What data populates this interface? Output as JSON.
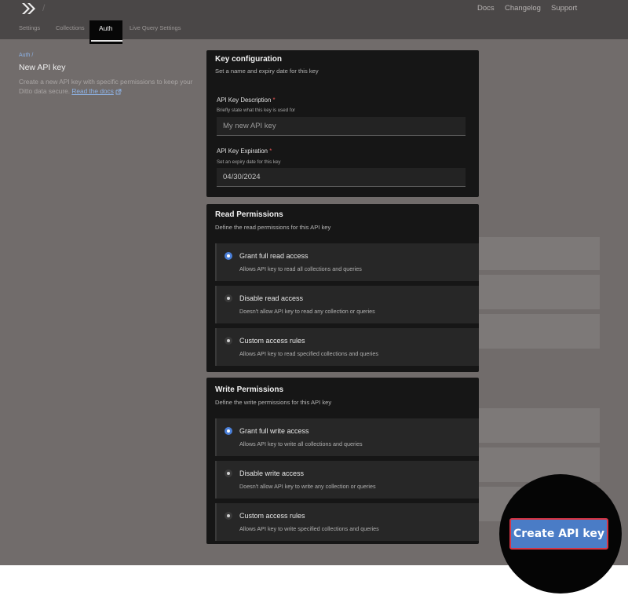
{
  "header": {
    "links": [
      "Docs",
      "Changelog",
      "Support"
    ],
    "tabs": [
      "Settings",
      "Collections",
      "Auth",
      "Live Query Settings"
    ],
    "active_tab": "Auth",
    "divider": "/"
  },
  "page": {
    "breadcrumb": "Auth /",
    "title": "New API key",
    "description": "Create a new API key with specific permissions to keep your Ditto data secure.",
    "docs_link": "Read the docs"
  },
  "key_config": {
    "title": "Key configuration",
    "subtitle": "Set a name and expiry date for this key",
    "description_label": "API Key Description",
    "description_hint": "Briefly state what this key is used for",
    "description_placeholder": "My new API key",
    "expiration_label": "API Key Expiration",
    "expiration_hint": "Set an expiry date for this key",
    "expiration_value": "04/30/2024",
    "required_mark": "*"
  },
  "read_permissions": {
    "title": "Read Permissions",
    "subtitle": "Define the read permissions for this API key",
    "options": [
      {
        "title": "Grant full read access",
        "desc": "Allows API key to read all collections and queries"
      },
      {
        "title": "Disable read access",
        "desc": "Doesn't allow API key to read any collection or queries"
      },
      {
        "title": "Custom access rules",
        "desc": "Allows API key to read specified collections and queries"
      }
    ]
  },
  "write_permissions": {
    "title": "Write Permissions",
    "subtitle": "Define the write permissions for this API key",
    "options": [
      {
        "title": "Grant full write access",
        "desc": "Allows API key to write all collections and queries"
      },
      {
        "title": "Disable write access",
        "desc": "Doesn't allow API key to write any collection or queries"
      },
      {
        "title": "Custom access rules",
        "desc": "Allows API key to write specified collections and queries"
      }
    ]
  },
  "create_button": "Create API key",
  "colors": {
    "accent": "#4a7cc6",
    "highlight_border": "#d63545",
    "required": "#e15454"
  },
  "icons": [
    "ditto-logo-icon",
    "external-link-icon",
    "radio-selected-icon",
    "radio-unselected-icon"
  ]
}
